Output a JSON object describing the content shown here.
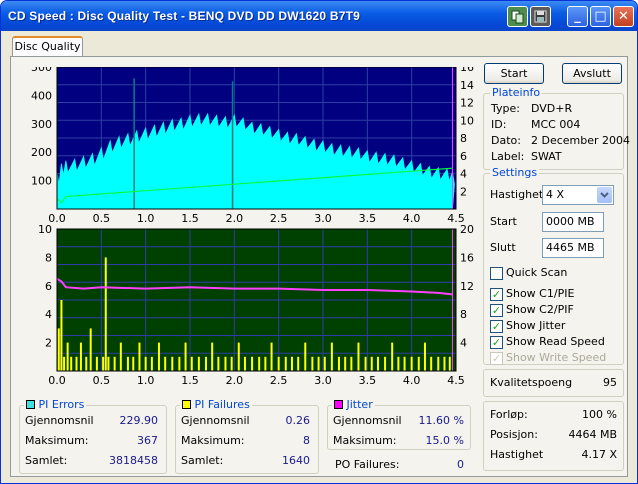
{
  "window": {
    "title": "CD Speed : Disc Quality Test - BENQ    DVD DD DW1620    B7T9",
    "minimize_glyph": "_",
    "maximize_glyph": "□",
    "close_glyph": "✕"
  },
  "tab": {
    "label": "Disc Quality"
  },
  "buttons": {
    "start": "Start",
    "exit": "Avslutt"
  },
  "plateinfo": {
    "title": "Plateinfo",
    "type_label": "Type:",
    "type_value": "DVD+R",
    "id_label": "ID:",
    "id_value": "MCC 004",
    "date_label": "Dato:",
    "date_value": "2 December 2004",
    "label_label": "Label:",
    "label_value": "SWAT"
  },
  "settings": {
    "title": "Settings",
    "speed_label": "Hastighet",
    "speed_value": "4 X",
    "start_label": "Start",
    "start_value": "0000 MB",
    "end_label": "Slutt",
    "end_value": "4465 MB",
    "quick_scan": "Quick Scan",
    "show_c1": "Show C1/PIE",
    "show_c2": "Show C2/PIF",
    "show_jitter": "Show Jitter",
    "show_read": "Show Read Speed",
    "show_write": "Show Write Speed",
    "checks": {
      "quick_scan": false,
      "show_c1": true,
      "show_c2": true,
      "show_jitter": true,
      "show_read": true,
      "show_write": true
    },
    "check_glyph": "✓"
  },
  "quality": {
    "label": "Kvalitetspoeng",
    "value": "95"
  },
  "progress": {
    "progress_label": "Forløp:",
    "progress_value": "100 %",
    "position_label": "Posisjon:",
    "position_value": "4464 MB",
    "speed_label": "Hastighet",
    "speed_value": "4.17 X"
  },
  "pi_errors": {
    "title": "PI Errors",
    "color": "#40e0e0",
    "avg_label": "Gjennomsnil",
    "avg": "229.90",
    "max_label": "Maksimum:",
    "max": "367",
    "total_label": "Samlet:",
    "total": "3818458"
  },
  "pi_failures": {
    "title": "PI Failures",
    "color": "#ffff00",
    "avg_label": "Gjennomsnil",
    "avg": "0.26",
    "max_label": "Maksimum:",
    "max": "8",
    "total_label": "Samlet:",
    "total": "1640"
  },
  "jitter": {
    "title": "Jitter",
    "color": "#ff00ff",
    "avg_label": "Gjennomsnil",
    "avg": "11.60 %",
    "max_label": "Maksimum:",
    "max": "15.0 %",
    "po_label": "PO Failures:",
    "po": "0"
  },
  "chart_data": [
    {
      "type": "area",
      "name": "pi-errors-chart",
      "x_ticks": [
        "0.0",
        "0.5",
        "1.0",
        "1.5",
        "2.0",
        "2.5",
        "3.0",
        "3.5",
        "4.0",
        "4.5"
      ],
      "xlim": [
        0,
        4.5
      ],
      "y_left_ticks": [
        "100",
        "200",
        "300",
        "400",
        "500"
      ],
      "ylim_left": [
        0,
        500
      ],
      "y_right_ticks": [
        "2",
        "4",
        "6",
        "8",
        "10",
        "12",
        "14",
        "16"
      ],
      "ylim_right": [
        0,
        16
      ],
      "background": "#000080",
      "grid": true,
      "series": [
        {
          "color": "#00ffff",
          "x": [
            0.0,
            0.05,
            0.1,
            0.2,
            0.3,
            0.4,
            0.5,
            0.6,
            0.7,
            0.8,
            0.9,
            1.0,
            1.1,
            1.2,
            1.3,
            1.4,
            1.5,
            1.6,
            1.7,
            1.8,
            1.9,
            2.0,
            2.1,
            2.2,
            2.3,
            2.4,
            2.5,
            2.6,
            2.7,
            2.8,
            2.9,
            3.0,
            3.1,
            3.2,
            3.3,
            3.4,
            3.5,
            3.6,
            3.7,
            3.8,
            3.9,
            4.0,
            4.1,
            4.2,
            4.3,
            4.4,
            4.46
          ],
          "y": [
            130,
            160,
            170,
            175,
            185,
            195,
            215,
            240,
            255,
            265,
            275,
            285,
            295,
            305,
            315,
            320,
            330,
            335,
            335,
            330,
            325,
            330,
            320,
            305,
            300,
            290,
            280,
            270,
            265,
            255,
            245,
            240,
            230,
            225,
            220,
            215,
            205,
            200,
            195,
            190,
            180,
            170,
            160,
            150,
            145,
            140,
            130
          ],
          "spikes": [
            [
              0.87,
              460
            ],
            [
              1.98,
              450
            ]
          ]
        },
        {
          "color": "#00ff40",
          "axis": "right",
          "x": [
            0.0,
            0.05,
            0.1,
            4.46
          ],
          "y": [
            1.2,
            0.7,
            1.4,
            4.6
          ]
        }
      ]
    },
    {
      "type": "bar",
      "name": "pi-failures-chart",
      "x_ticks": [
        "0.0",
        "0.5",
        "1.0",
        "1.5",
        "2.0",
        "2.5",
        "3.0",
        "3.5",
        "4.0",
        "4.5"
      ],
      "xlim": [
        0,
        4.5
      ],
      "y_left_ticks": [
        "2",
        "4",
        "6",
        "8",
        "10"
      ],
      "ylim_left": [
        0,
        10
      ],
      "y_right_ticks": [
        "4",
        "8",
        "12",
        "16",
        "20"
      ],
      "ylim_right": [
        0,
        20
      ],
      "background": "#004000",
      "grid": true,
      "series": [
        {
          "color": "#ffff00",
          "x": [
            0.02,
            0.05,
            0.08,
            0.12,
            0.16,
            0.22,
            0.27,
            0.33,
            0.38,
            0.45,
            0.52,
            0.55,
            0.58,
            0.65,
            0.72,
            0.8,
            0.86,
            0.93,
            1.0,
            1.07,
            1.15,
            1.22,
            1.3,
            1.38,
            1.45,
            1.52,
            1.6,
            1.68,
            1.75,
            1.82,
            1.9,
            1.97,
            2.05,
            2.12,
            2.2,
            2.28,
            2.35,
            2.42,
            2.5,
            2.58,
            2.65,
            2.72,
            2.8,
            2.88,
            2.95,
            3.02,
            3.1,
            3.18,
            3.25,
            3.32,
            3.4,
            3.48,
            3.55,
            3.62,
            3.7,
            3.78,
            3.85,
            3.92,
            4.0,
            4.08,
            4.15,
            4.22,
            4.3,
            4.37,
            4.43
          ],
          "y": [
            3,
            5,
            1,
            2,
            1,
            1,
            2,
            1,
            3,
            1,
            1,
            8,
            1,
            1,
            2,
            1,
            1,
            2,
            1,
            1,
            2,
            1,
            1,
            1,
            2,
            1,
            1,
            1,
            2,
            1,
            1,
            1,
            2,
            1,
            1,
            1,
            1,
            2,
            1,
            1,
            1,
            1,
            2,
            1,
            1,
            1,
            2,
            1,
            1,
            1,
            2,
            1,
            1,
            1,
            1,
            2,
            1,
            1,
            1,
            1,
            2,
            1,
            1,
            1,
            1
          ]
        },
        {
          "color": "#ff40ff",
          "axis": "right",
          "x": [
            0.0,
            0.05,
            0.1,
            0.3,
            0.5,
            1.0,
            1.5,
            2.0,
            2.5,
            3.0,
            3.5,
            4.0,
            4.3,
            4.46
          ],
          "y": [
            13.0,
            12.6,
            11.8,
            11.6,
            11.8,
            11.6,
            11.8,
            11.6,
            11.6,
            11.4,
            11.4,
            11.2,
            11.0,
            10.8
          ]
        }
      ]
    }
  ]
}
